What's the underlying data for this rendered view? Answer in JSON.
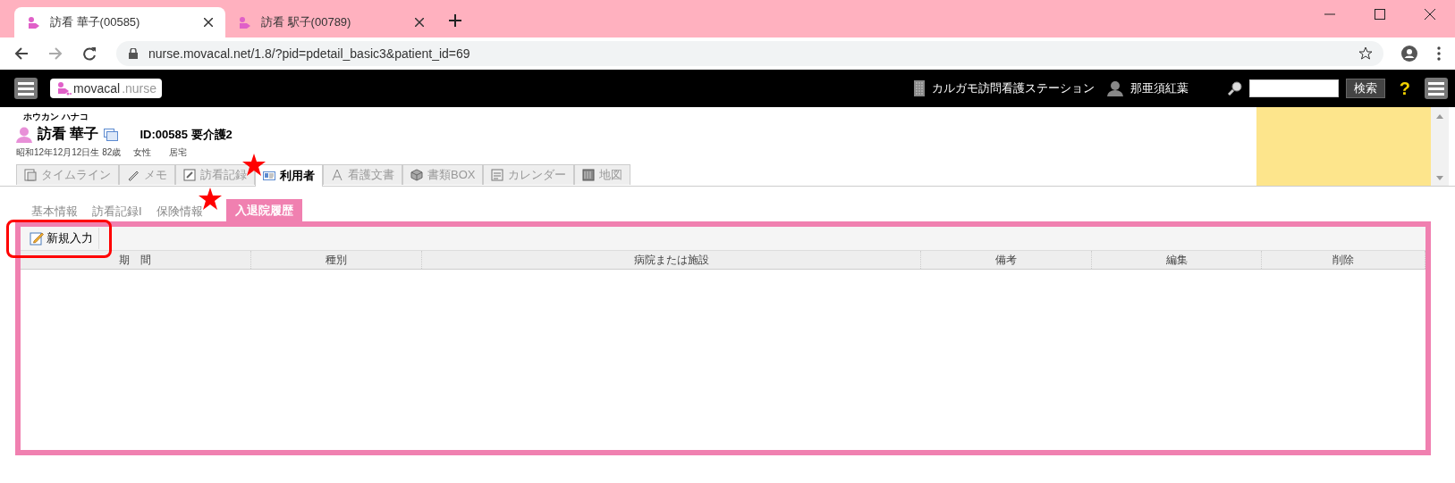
{
  "browser": {
    "tabs": [
      {
        "title": "訪看 華子(00585)",
        "selected": true
      },
      {
        "title": "訪看 駅子(00789)",
        "selected": false
      }
    ],
    "url": "nurse.movacal.net/1.8/?pid=pdetail_basic3&patient_id=69"
  },
  "app_header": {
    "logo_main": "movacal",
    "logo_sub": ".nurse",
    "station": "カルガモ訪問看護ステーション",
    "user": "那亜須紅葉",
    "search_button": "検索",
    "help": "?"
  },
  "patient": {
    "kana": "ホウカン ハナコ",
    "name": "訪看 華子",
    "id_care": "ID:00585 要介護2",
    "birth": "昭和12年12月12日生 82歳",
    "sex": "女性",
    "residence": "居宅"
  },
  "main_tabs": [
    {
      "label": "タイムライン",
      "selected": false
    },
    {
      "label": "メモ",
      "selected": false
    },
    {
      "label": "訪看記録",
      "selected": false
    },
    {
      "label": "利用者",
      "selected": true
    },
    {
      "label": "看護文書",
      "selected": false
    },
    {
      "label": "書類BOX",
      "selected": false
    },
    {
      "label": "カレンダー",
      "selected": false
    },
    {
      "label": "地図",
      "selected": false
    }
  ],
  "sub_tabs": [
    {
      "label": "基本情報",
      "selected": false
    },
    {
      "label": "訪看記録I",
      "selected": false
    },
    {
      "label": "保険情報",
      "selected": false
    },
    {
      "label": "入退院履歴",
      "selected": true
    }
  ],
  "toolbar": {
    "new_button": "新規入力"
  },
  "table": {
    "columns": [
      "期　間",
      "種別",
      "病院または施設",
      "備考",
      "編集",
      "削除"
    ]
  }
}
